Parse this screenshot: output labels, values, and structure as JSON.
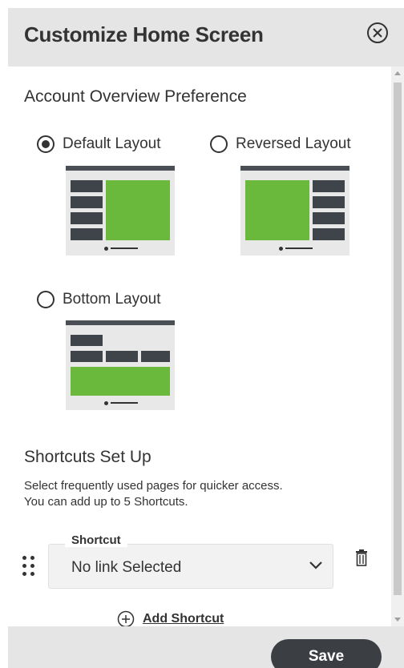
{
  "header": {
    "title": "Customize Home Screen"
  },
  "account_overview": {
    "title": "Account Overview Preference",
    "options": [
      {
        "label": "Default Layout",
        "selected": true
      },
      {
        "label": "Reversed Layout",
        "selected": false
      },
      {
        "label": "Bottom Layout",
        "selected": false
      }
    ]
  },
  "shortcuts": {
    "title": "Shortcuts Set Up",
    "description_line1": "Select frequently used pages for quicker access.",
    "description_line2": "You can add up to 5 Shortcuts.",
    "field_label": "Shortcut",
    "field_value": "No link Selected",
    "add_label": "Add Shortcut"
  },
  "footer": {
    "save_label": "Save"
  },
  "colors": {
    "accent_green": "#6bb93c",
    "dark": "#3b3f44",
    "panel_gray": "#e5e5e5"
  },
  "icons": [
    "close-circle-icon",
    "radio-icon",
    "drag-handle-icon",
    "chevron-down-icon",
    "trash-icon",
    "plus-circle-icon"
  ]
}
